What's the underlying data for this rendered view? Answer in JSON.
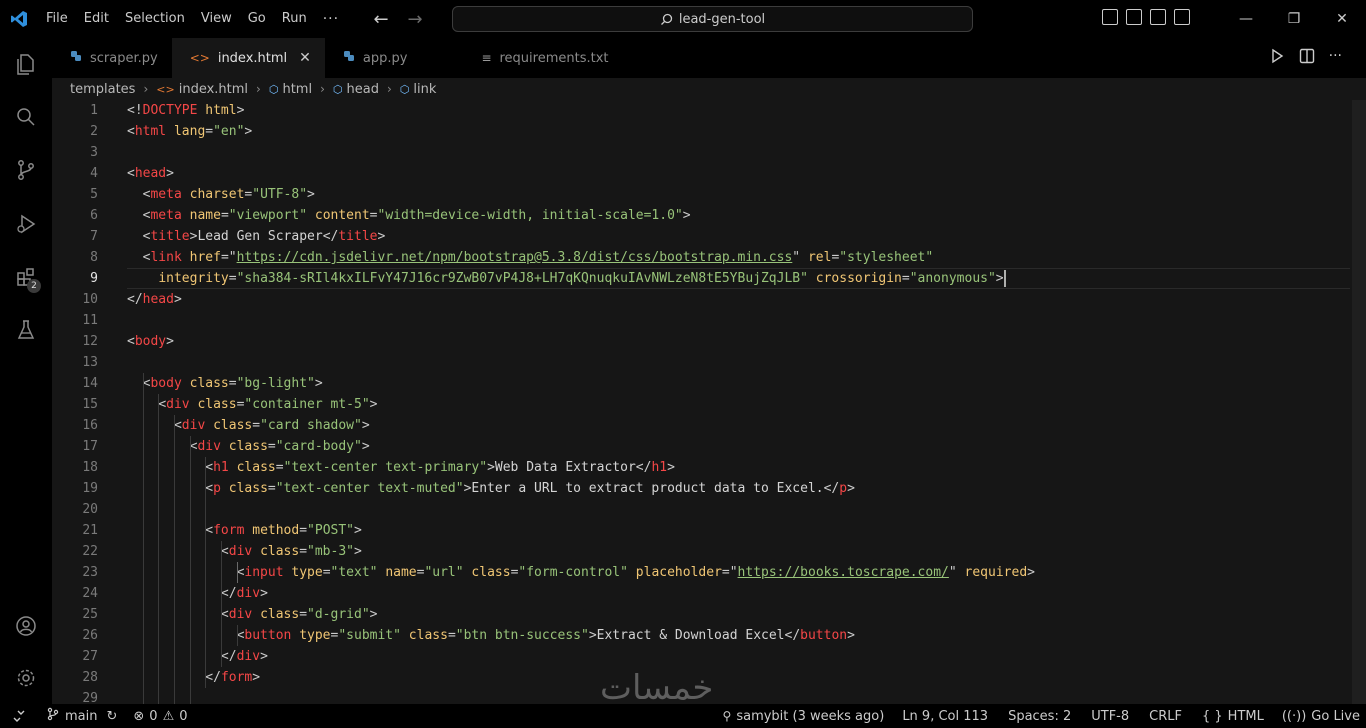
{
  "menu": [
    "File",
    "Edit",
    "Selection",
    "View",
    "Go",
    "Run"
  ],
  "menu_more": "···",
  "search": {
    "text": "lead-gen-tool"
  },
  "tabs": [
    {
      "label": "scraper.py",
      "icon": "python-icon",
      "active": false
    },
    {
      "label": "index.html",
      "icon": "html-icon",
      "active": true
    },
    {
      "label": "app.py",
      "icon": "python-icon",
      "active": false
    },
    {
      "label": "requirements.txt",
      "icon": "text-file-icon",
      "active": false
    }
  ],
  "breadcrumb": [
    "templates",
    "index.html",
    "html",
    "head",
    "link"
  ],
  "activity_badge": "2",
  "editor": {
    "current_line": 9,
    "line_numbers": [
      "1",
      "2",
      "3",
      "4",
      "5",
      "6",
      "7",
      "8",
      "9",
      "10",
      "11",
      "12",
      "13",
      "14",
      "15",
      "16",
      "17",
      "18",
      "19",
      "20",
      "21",
      "22",
      "23",
      "24",
      "25",
      "26",
      "27",
      "28",
      "29"
    ],
    "lines": [
      [
        [
          "p",
          "<!"
        ],
        [
          "t",
          "DOCTYPE"
        ],
        [
          "x",
          " "
        ],
        [
          "a",
          "html"
        ],
        [
          "p",
          ">"
        ]
      ],
      [
        [
          "p",
          "<"
        ],
        [
          "t",
          "html"
        ],
        [
          "x",
          " "
        ],
        [
          "a",
          "lang"
        ],
        [
          "p",
          "="
        ],
        [
          "s",
          "\"en\""
        ],
        [
          "p",
          ">"
        ]
      ],
      [],
      [
        [
          "p",
          "<"
        ],
        [
          "t",
          "head"
        ],
        [
          "p",
          ">"
        ]
      ],
      [
        [
          "x",
          "  "
        ],
        [
          "p",
          "<"
        ],
        [
          "t",
          "meta"
        ],
        [
          "x",
          " "
        ],
        [
          "a",
          "charset"
        ],
        [
          "p",
          "="
        ],
        [
          "s",
          "\"UTF-8\""
        ],
        [
          "p",
          ">"
        ]
      ],
      [
        [
          "x",
          "  "
        ],
        [
          "p",
          "<"
        ],
        [
          "t",
          "meta"
        ],
        [
          "x",
          " "
        ],
        [
          "a",
          "name"
        ],
        [
          "p",
          "="
        ],
        [
          "s",
          "\"viewport\""
        ],
        [
          "x",
          " "
        ],
        [
          "a",
          "content"
        ],
        [
          "p",
          "="
        ],
        [
          "s",
          "\"width=device-width, initial-scale=1.0\""
        ],
        [
          "p",
          ">"
        ]
      ],
      [
        [
          "x",
          "  "
        ],
        [
          "p",
          "<"
        ],
        [
          "t",
          "title"
        ],
        [
          "p",
          ">"
        ],
        [
          "x",
          "Lead Gen Scraper"
        ],
        [
          "p",
          "</"
        ],
        [
          "t",
          "title"
        ],
        [
          "p",
          ">"
        ]
      ],
      [
        [
          "x",
          "  "
        ],
        [
          "p",
          "<"
        ],
        [
          "t",
          "link"
        ],
        [
          "x",
          " "
        ],
        [
          "a",
          "href"
        ],
        [
          "p",
          "="
        ],
        [
          "p",
          "\""
        ],
        [
          "u",
          "https://cdn.jsdelivr.net/npm/bootstrap@5.3.8/dist/css/bootstrap.min.css"
        ],
        [
          "p",
          "\""
        ],
        [
          "x",
          " "
        ],
        [
          "a",
          "rel"
        ],
        [
          "p",
          "="
        ],
        [
          "s",
          "\"stylesheet\""
        ]
      ],
      [
        [
          "x",
          "    "
        ],
        [
          "a",
          "integrity"
        ],
        [
          "p",
          "="
        ],
        [
          "s",
          "\"sha384-sRIl4kxILFvY47J16cr9ZwB07vP4J8+LH7qKQnuqkuIAvNWLzeN8tE5YBujZqJLB\""
        ],
        [
          "x",
          " "
        ],
        [
          "a",
          "crossorigin"
        ],
        [
          "p",
          "="
        ],
        [
          "s",
          "\"anonymous\""
        ],
        [
          "p",
          ">"
        ]
      ],
      [
        [
          "p",
          "</"
        ],
        [
          "t",
          "head"
        ],
        [
          "p",
          ">"
        ]
      ],
      [],
      [
        [
          "p",
          "<"
        ],
        [
          "t",
          "body"
        ],
        [
          "p",
          ">"
        ]
      ],
      [],
      [
        [
          "x",
          "  "
        ],
        [
          "p",
          "<"
        ],
        [
          "t",
          "body"
        ],
        [
          "x",
          " "
        ],
        [
          "a",
          "class"
        ],
        [
          "p",
          "="
        ],
        [
          "s",
          "\"bg-light\""
        ],
        [
          "p",
          ">"
        ]
      ],
      [
        [
          "x",
          "    "
        ],
        [
          "p",
          "<"
        ],
        [
          "t",
          "div"
        ],
        [
          "x",
          " "
        ],
        [
          "a",
          "class"
        ],
        [
          "p",
          "="
        ],
        [
          "s",
          "\"container mt-5\""
        ],
        [
          "p",
          ">"
        ]
      ],
      [
        [
          "x",
          "      "
        ],
        [
          "p",
          "<"
        ],
        [
          "t",
          "div"
        ],
        [
          "x",
          " "
        ],
        [
          "a",
          "class"
        ],
        [
          "p",
          "="
        ],
        [
          "s",
          "\"card shadow\""
        ],
        [
          "p",
          ">"
        ]
      ],
      [
        [
          "x",
          "        "
        ],
        [
          "p",
          "<"
        ],
        [
          "t",
          "div"
        ],
        [
          "x",
          " "
        ],
        [
          "a",
          "class"
        ],
        [
          "p",
          "="
        ],
        [
          "s",
          "\"card-body\""
        ],
        [
          "p",
          ">"
        ]
      ],
      [
        [
          "x",
          "          "
        ],
        [
          "p",
          "<"
        ],
        [
          "t",
          "h1"
        ],
        [
          "x",
          " "
        ],
        [
          "a",
          "class"
        ],
        [
          "p",
          "="
        ],
        [
          "s",
          "\"text-center text-primary\""
        ],
        [
          "p",
          ">"
        ],
        [
          "x",
          "Web Data Extractor"
        ],
        [
          "p",
          "</"
        ],
        [
          "t",
          "h1"
        ],
        [
          "p",
          ">"
        ]
      ],
      [
        [
          "x",
          "          "
        ],
        [
          "p",
          "<"
        ],
        [
          "t",
          "p"
        ],
        [
          "x",
          " "
        ],
        [
          "a",
          "class"
        ],
        [
          "p",
          "="
        ],
        [
          "s",
          "\"text-center text-muted\""
        ],
        [
          "p",
          ">"
        ],
        [
          "x",
          "Enter a URL to extract product data to Excel."
        ],
        [
          "p",
          "</"
        ],
        [
          "t",
          "p"
        ],
        [
          "p",
          ">"
        ]
      ],
      [],
      [
        [
          "x",
          "          "
        ],
        [
          "p",
          "<"
        ],
        [
          "t",
          "form"
        ],
        [
          "x",
          " "
        ],
        [
          "a",
          "method"
        ],
        [
          "p",
          "="
        ],
        [
          "s",
          "\"POST\""
        ],
        [
          "p",
          ">"
        ]
      ],
      [
        [
          "x",
          "            "
        ],
        [
          "p",
          "<"
        ],
        [
          "t",
          "div"
        ],
        [
          "x",
          " "
        ],
        [
          "a",
          "class"
        ],
        [
          "p",
          "="
        ],
        [
          "s",
          "\"mb-3\""
        ],
        [
          "p",
          ">"
        ]
      ],
      [
        [
          "x",
          "              "
        ],
        [
          "p",
          "<"
        ],
        [
          "t",
          "input"
        ],
        [
          "x",
          " "
        ],
        [
          "a",
          "type"
        ],
        [
          "p",
          "="
        ],
        [
          "s",
          "\"text\""
        ],
        [
          "x",
          " "
        ],
        [
          "a",
          "name"
        ],
        [
          "p",
          "="
        ],
        [
          "s",
          "\"url\""
        ],
        [
          "x",
          " "
        ],
        [
          "a",
          "class"
        ],
        [
          "p",
          "="
        ],
        [
          "s",
          "\"form-control\""
        ],
        [
          "x",
          " "
        ],
        [
          "a",
          "placeholder"
        ],
        [
          "p",
          "="
        ],
        [
          "p",
          "\""
        ],
        [
          "u",
          "https://books.toscrape.com/"
        ],
        [
          "p",
          "\""
        ],
        [
          "x",
          " "
        ],
        [
          "a",
          "required"
        ],
        [
          "p",
          ">"
        ]
      ],
      [
        [
          "x",
          "            "
        ],
        [
          "p",
          "</"
        ],
        [
          "t",
          "div"
        ],
        [
          "p",
          ">"
        ]
      ],
      [
        [
          "x",
          "            "
        ],
        [
          "p",
          "<"
        ],
        [
          "t",
          "div"
        ],
        [
          "x",
          " "
        ],
        [
          "a",
          "class"
        ],
        [
          "p",
          "="
        ],
        [
          "s",
          "\"d-grid\""
        ],
        [
          "p",
          ">"
        ]
      ],
      [
        [
          "x",
          "              "
        ],
        [
          "p",
          "<"
        ],
        [
          "t",
          "button"
        ],
        [
          "x",
          " "
        ],
        [
          "a",
          "type"
        ],
        [
          "p",
          "="
        ],
        [
          "s",
          "\"submit\""
        ],
        [
          "x",
          " "
        ],
        [
          "a",
          "class"
        ],
        [
          "p",
          "="
        ],
        [
          "s",
          "\"btn btn-success\""
        ],
        [
          "p",
          ">"
        ],
        [
          "x",
          "Extract & Download Excel"
        ],
        [
          "p",
          "</"
        ],
        [
          "t",
          "button"
        ],
        [
          "p",
          ">"
        ]
      ],
      [
        [
          "x",
          "            "
        ],
        [
          "p",
          "</"
        ],
        [
          "t",
          "div"
        ],
        [
          "p",
          ">"
        ]
      ],
      [
        [
          "x",
          "          "
        ],
        [
          "p",
          "</"
        ],
        [
          "t",
          "form"
        ],
        [
          "p",
          ">"
        ]
      ],
      []
    ]
  },
  "status": {
    "branch": "main",
    "errors": "0",
    "warnings": "0",
    "blame": "samybit (3 weeks ago)",
    "position": "Ln 9, Col 113",
    "spaces": "Spaces: 2",
    "encoding": "UTF-8",
    "eol": "CRLF",
    "language_braces": "{ }",
    "language": "HTML",
    "golive": "Go Live"
  },
  "watermark": "خمسات"
}
